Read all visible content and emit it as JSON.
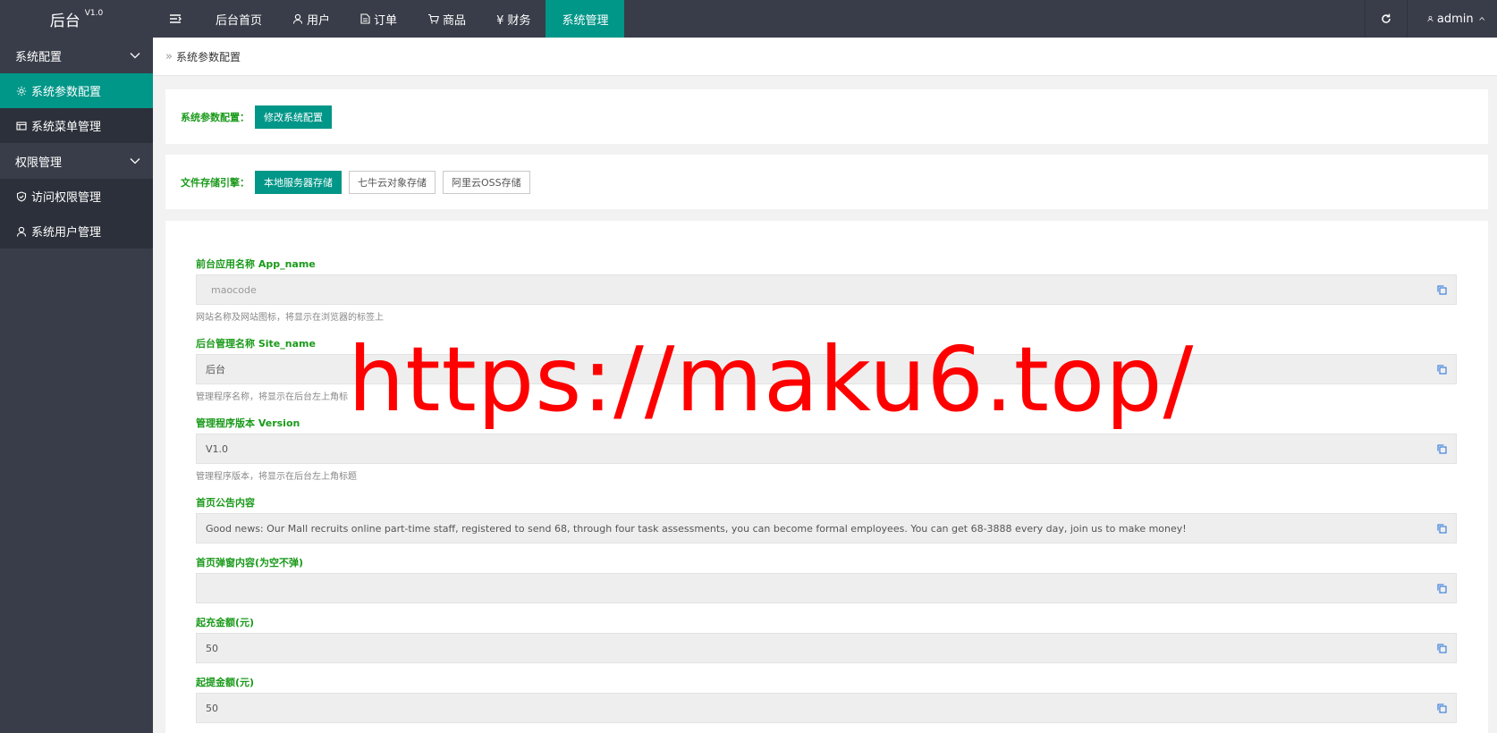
{
  "header": {
    "logo": "后台",
    "version": "V1.0",
    "nav": [
      {
        "label": "后台首页"
      },
      {
        "label": "用户"
      },
      {
        "label": "订单"
      },
      {
        "label": "商品"
      },
      {
        "label": "¥ 财务"
      },
      {
        "label": "系统管理"
      }
    ],
    "user": "admin"
  },
  "sidebar": {
    "groups": [
      {
        "label": "系统配置",
        "items": [
          {
            "label": "系统参数配置"
          },
          {
            "label": "系统菜单管理"
          }
        ]
      },
      {
        "label": "权限管理",
        "items": [
          {
            "label": "访问权限管理"
          },
          {
            "label": "系统用户管理"
          }
        ]
      }
    ]
  },
  "breadcrumb": {
    "sep": "»",
    "current": "系统参数配置"
  },
  "config_card": {
    "label": "系统参数配置：",
    "button": "修改系统配置"
  },
  "storage_card": {
    "label": "文件存储引擎：",
    "options": [
      "本地服务器存储",
      "七牛云对象存储",
      "阿里云OSS存储"
    ],
    "selected": "本地服务器存储"
  },
  "fields": [
    {
      "label": "前台应用名称 App_name",
      "value": "maocode",
      "help": "网站名称及网站图标，将显示在浏览器的标签上"
    },
    {
      "label": "后台管理名称 Site_name",
      "value": "后台",
      "help": "管理程序名称，将显示在后台左上角标"
    },
    {
      "label": "管理程序版本 Version",
      "value": "V1.0",
      "help": "管理程序版本，将显示在后台左上角标题"
    },
    {
      "label": "首页公告内容",
      "value": "Good news: Our Mall recruits online part-time staff, registered to send 68, through four task assessments, you can become formal employees. You can get 68-3888 every day, join us to make money!",
      "help": ""
    },
    {
      "label": "首页弹窗内容(为空不弹)",
      "value": "",
      "help": ""
    },
    {
      "label": "起充金额(元)",
      "value": "50",
      "help": ""
    },
    {
      "label": "起提金额(元)",
      "value": "50",
      "help": ""
    }
  ],
  "watermark": "https://maku6.top/",
  "colors": {
    "topbar": "#393d49",
    "accent": "#009688",
    "label_green": "#1a9a1a",
    "watermark": "#ff0000"
  }
}
